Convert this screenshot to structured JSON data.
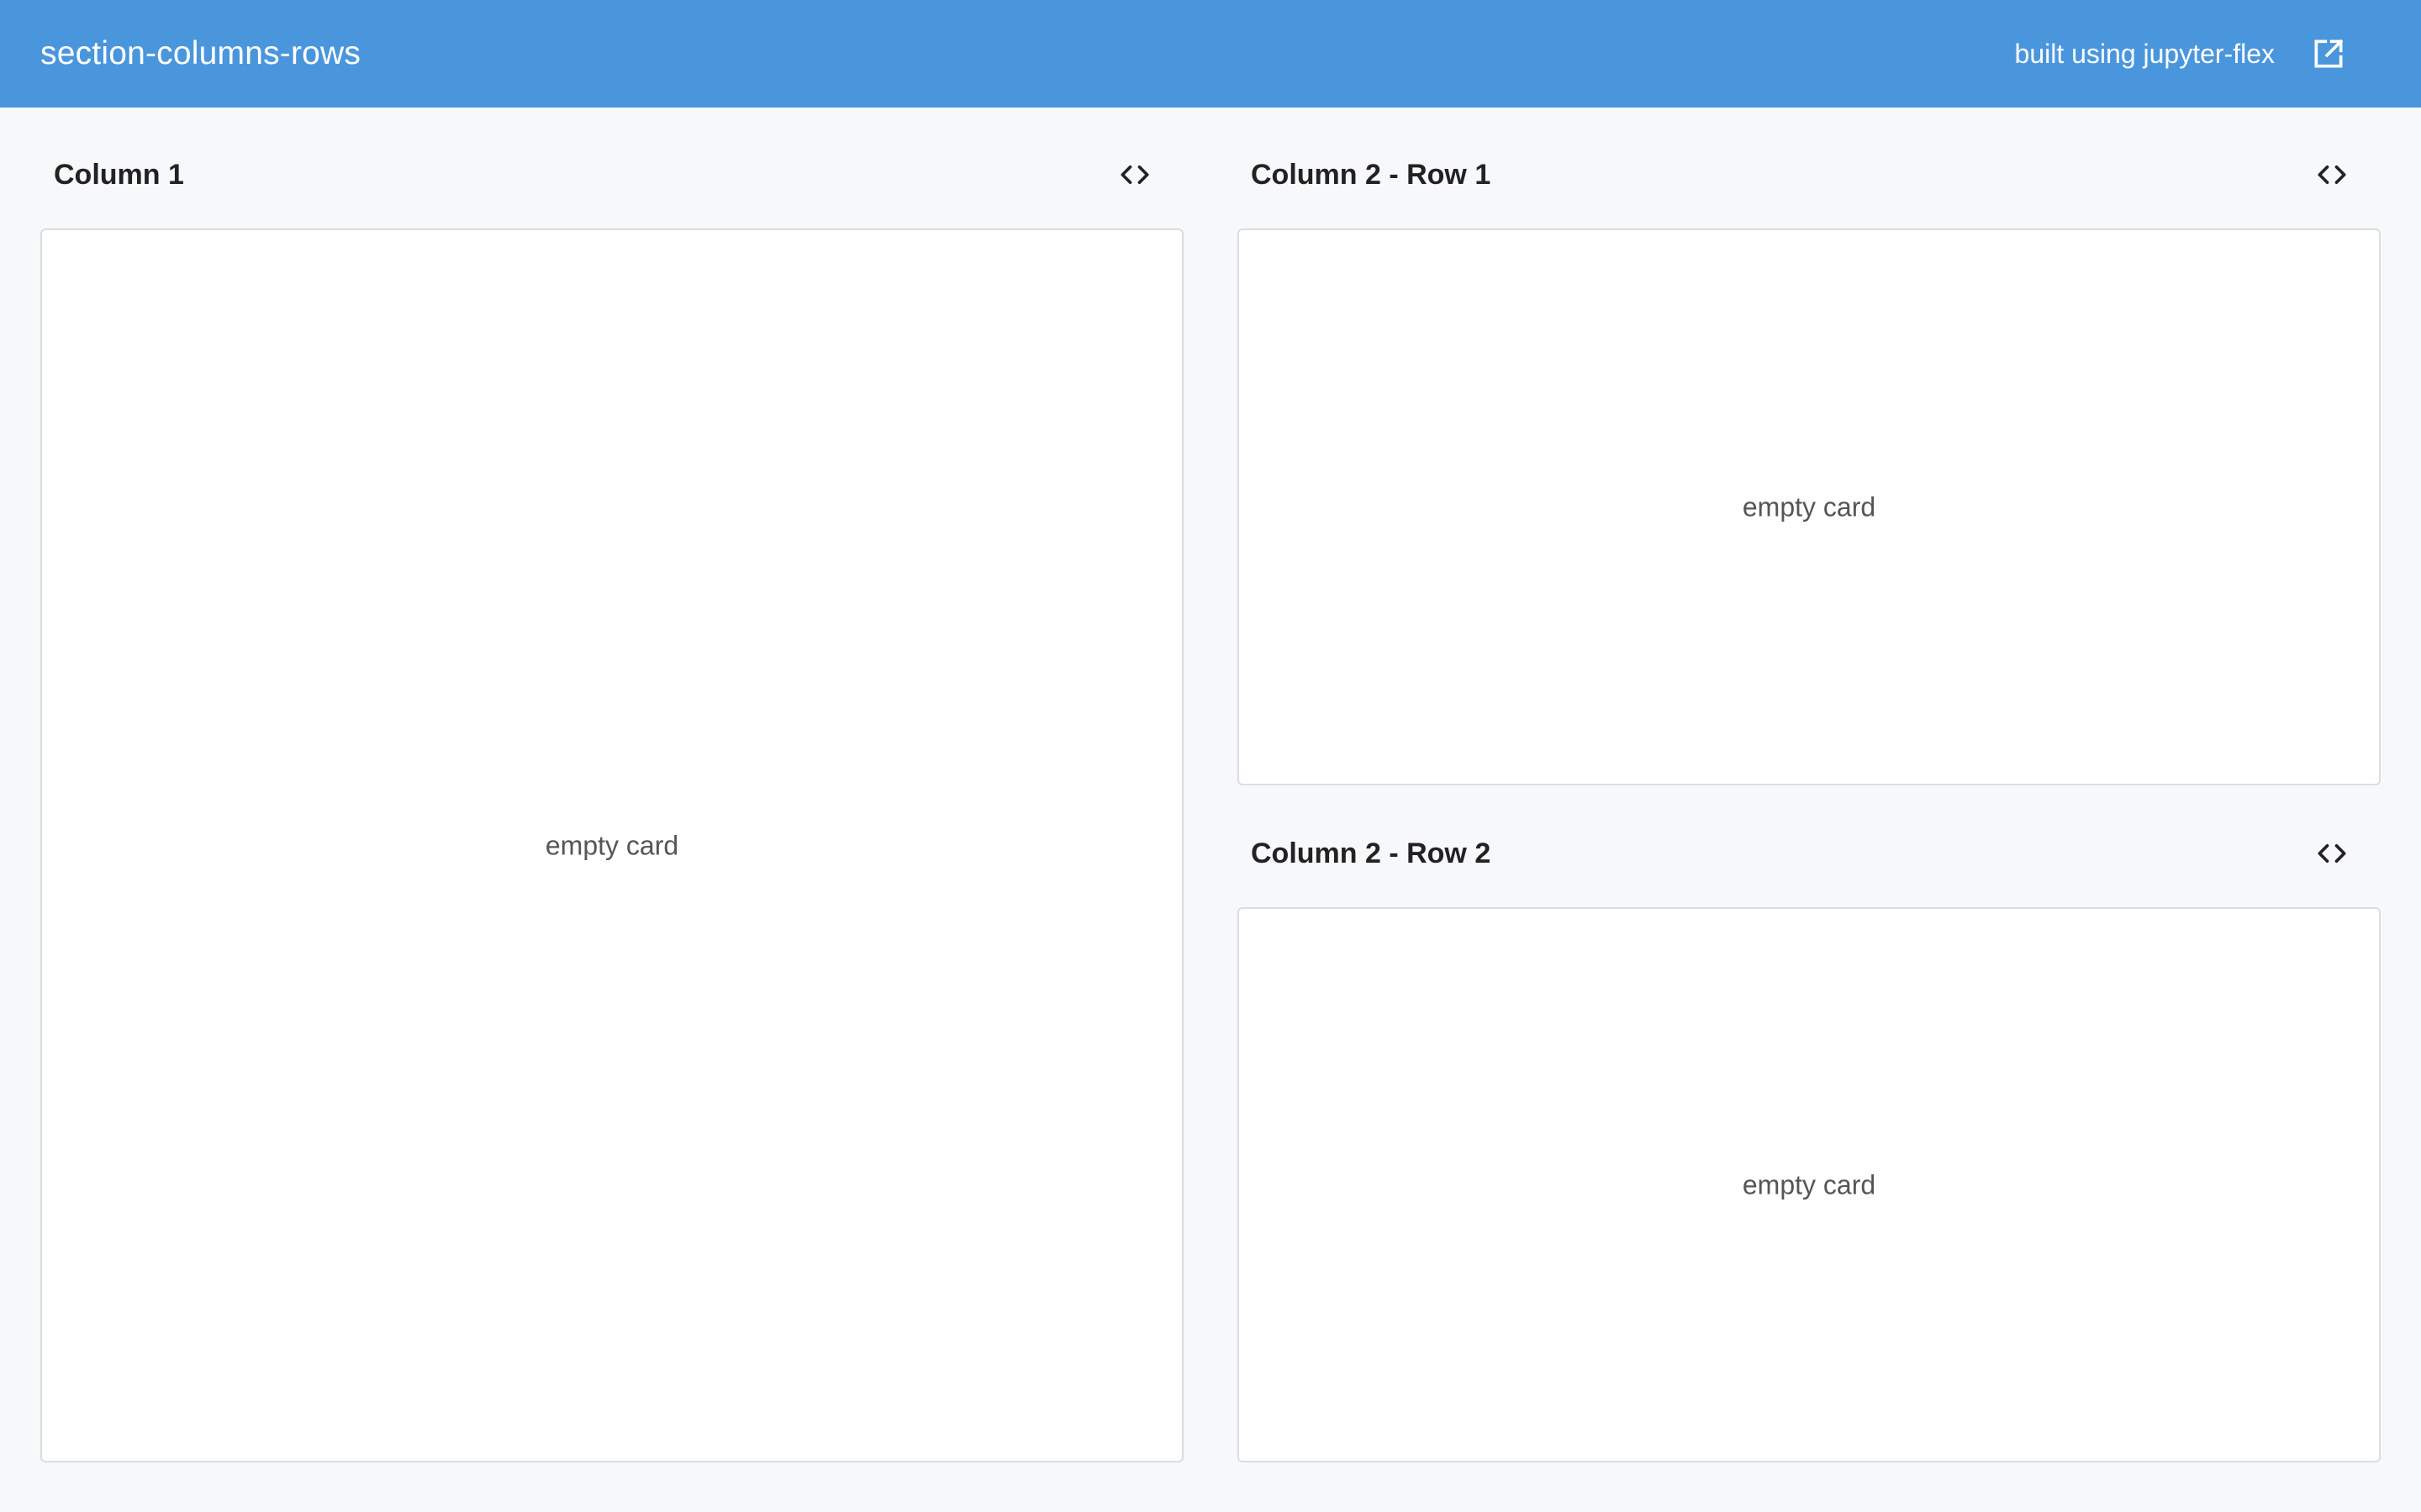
{
  "navbar": {
    "title": "section-columns-rows",
    "built_with": "built using jupyter-flex",
    "external_icon": "external-link-icon",
    "background": "#4a96dd"
  },
  "sections": [
    {
      "title": "Column 1",
      "toggle_icon": "code-icon",
      "card_text": "empty card"
    },
    {
      "title": "Column 2 - Row 1",
      "toggle_icon": "code-icon",
      "card_text": "empty card"
    },
    {
      "title": "Column 2 - Row 2",
      "toggle_icon": "code-icon",
      "card_text": "empty card"
    }
  ]
}
